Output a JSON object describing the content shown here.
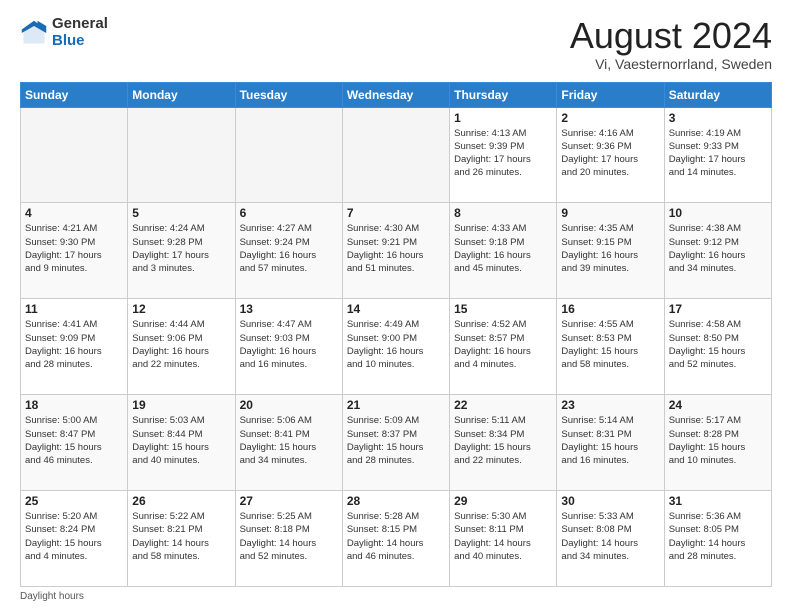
{
  "logo": {
    "general": "General",
    "blue": "Blue"
  },
  "title": "August 2024",
  "location": "Vi, Vaesternorrland, Sweden",
  "days_of_week": [
    "Sunday",
    "Monday",
    "Tuesday",
    "Wednesday",
    "Thursday",
    "Friday",
    "Saturday"
  ],
  "footer": "Daylight hours",
  "weeks": [
    [
      {
        "day": "",
        "info": ""
      },
      {
        "day": "",
        "info": ""
      },
      {
        "day": "",
        "info": ""
      },
      {
        "day": "",
        "info": ""
      },
      {
        "day": "1",
        "info": "Sunrise: 4:13 AM\nSunset: 9:39 PM\nDaylight: 17 hours\nand 26 minutes."
      },
      {
        "day": "2",
        "info": "Sunrise: 4:16 AM\nSunset: 9:36 PM\nDaylight: 17 hours\nand 20 minutes."
      },
      {
        "day": "3",
        "info": "Sunrise: 4:19 AM\nSunset: 9:33 PM\nDaylight: 17 hours\nand 14 minutes."
      }
    ],
    [
      {
        "day": "4",
        "info": "Sunrise: 4:21 AM\nSunset: 9:30 PM\nDaylight: 17 hours\nand 9 minutes."
      },
      {
        "day": "5",
        "info": "Sunrise: 4:24 AM\nSunset: 9:28 PM\nDaylight: 17 hours\nand 3 minutes."
      },
      {
        "day": "6",
        "info": "Sunrise: 4:27 AM\nSunset: 9:24 PM\nDaylight: 16 hours\nand 57 minutes."
      },
      {
        "day": "7",
        "info": "Sunrise: 4:30 AM\nSunset: 9:21 PM\nDaylight: 16 hours\nand 51 minutes."
      },
      {
        "day": "8",
        "info": "Sunrise: 4:33 AM\nSunset: 9:18 PM\nDaylight: 16 hours\nand 45 minutes."
      },
      {
        "day": "9",
        "info": "Sunrise: 4:35 AM\nSunset: 9:15 PM\nDaylight: 16 hours\nand 39 minutes."
      },
      {
        "day": "10",
        "info": "Sunrise: 4:38 AM\nSunset: 9:12 PM\nDaylight: 16 hours\nand 34 minutes."
      }
    ],
    [
      {
        "day": "11",
        "info": "Sunrise: 4:41 AM\nSunset: 9:09 PM\nDaylight: 16 hours\nand 28 minutes."
      },
      {
        "day": "12",
        "info": "Sunrise: 4:44 AM\nSunset: 9:06 PM\nDaylight: 16 hours\nand 22 minutes."
      },
      {
        "day": "13",
        "info": "Sunrise: 4:47 AM\nSunset: 9:03 PM\nDaylight: 16 hours\nand 16 minutes."
      },
      {
        "day": "14",
        "info": "Sunrise: 4:49 AM\nSunset: 9:00 PM\nDaylight: 16 hours\nand 10 minutes."
      },
      {
        "day": "15",
        "info": "Sunrise: 4:52 AM\nSunset: 8:57 PM\nDaylight: 16 hours\nand 4 minutes."
      },
      {
        "day": "16",
        "info": "Sunrise: 4:55 AM\nSunset: 8:53 PM\nDaylight: 15 hours\nand 58 minutes."
      },
      {
        "day": "17",
        "info": "Sunrise: 4:58 AM\nSunset: 8:50 PM\nDaylight: 15 hours\nand 52 minutes."
      }
    ],
    [
      {
        "day": "18",
        "info": "Sunrise: 5:00 AM\nSunset: 8:47 PM\nDaylight: 15 hours\nand 46 minutes."
      },
      {
        "day": "19",
        "info": "Sunrise: 5:03 AM\nSunset: 8:44 PM\nDaylight: 15 hours\nand 40 minutes."
      },
      {
        "day": "20",
        "info": "Sunrise: 5:06 AM\nSunset: 8:41 PM\nDaylight: 15 hours\nand 34 minutes."
      },
      {
        "day": "21",
        "info": "Sunrise: 5:09 AM\nSunset: 8:37 PM\nDaylight: 15 hours\nand 28 minutes."
      },
      {
        "day": "22",
        "info": "Sunrise: 5:11 AM\nSunset: 8:34 PM\nDaylight: 15 hours\nand 22 minutes."
      },
      {
        "day": "23",
        "info": "Sunrise: 5:14 AM\nSunset: 8:31 PM\nDaylight: 15 hours\nand 16 minutes."
      },
      {
        "day": "24",
        "info": "Sunrise: 5:17 AM\nSunset: 8:28 PM\nDaylight: 15 hours\nand 10 minutes."
      }
    ],
    [
      {
        "day": "25",
        "info": "Sunrise: 5:20 AM\nSunset: 8:24 PM\nDaylight: 15 hours\nand 4 minutes."
      },
      {
        "day": "26",
        "info": "Sunrise: 5:22 AM\nSunset: 8:21 PM\nDaylight: 14 hours\nand 58 minutes."
      },
      {
        "day": "27",
        "info": "Sunrise: 5:25 AM\nSunset: 8:18 PM\nDaylight: 14 hours\nand 52 minutes."
      },
      {
        "day": "28",
        "info": "Sunrise: 5:28 AM\nSunset: 8:15 PM\nDaylight: 14 hours\nand 46 minutes."
      },
      {
        "day": "29",
        "info": "Sunrise: 5:30 AM\nSunset: 8:11 PM\nDaylight: 14 hours\nand 40 minutes."
      },
      {
        "day": "30",
        "info": "Sunrise: 5:33 AM\nSunset: 8:08 PM\nDaylight: 14 hours\nand 34 minutes."
      },
      {
        "day": "31",
        "info": "Sunrise: 5:36 AM\nSunset: 8:05 PM\nDaylight: 14 hours\nand 28 minutes."
      }
    ]
  ]
}
